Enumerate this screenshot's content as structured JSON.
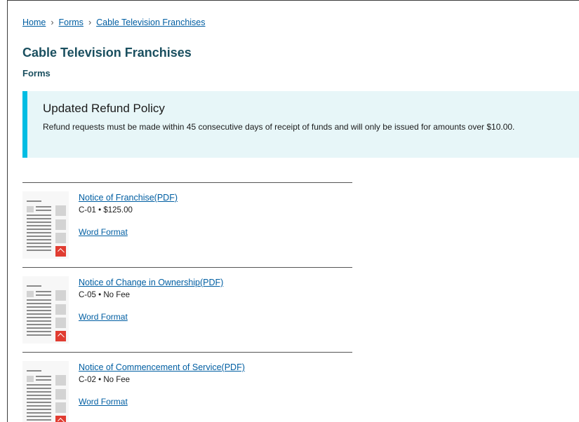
{
  "breadcrumb": {
    "items": [
      "Home",
      "Forms",
      "Cable Television Franchises"
    ],
    "separator": "›"
  },
  "page": {
    "title": "Cable Television Franchises",
    "subtitle": "Forms"
  },
  "alert": {
    "heading": "Updated Refund Policy",
    "body": "Refund requests must be made within 45 consecutive days of receipt of funds and will only be issued for amounts over $10.00."
  },
  "forms": [
    {
      "title": "Notice of Franchise(PDF)",
      "meta": "C-01 • $125.00",
      "word_label": "Word Format"
    },
    {
      "title": "Notice of Change in Ownership(PDF)",
      "meta": "C-05 • No Fee",
      "word_label": "Word Format"
    },
    {
      "title": "Notice of Commencement of Service(PDF)",
      "meta": "C-02 • No Fee",
      "word_label": "Word Format"
    }
  ],
  "colors": {
    "link": "#005ea2",
    "heading": "#1a4f5f",
    "alert_bg": "#e7f6f8",
    "alert_border": "#00bde3",
    "pdf_badge": "#e03c31"
  },
  "icons": {
    "form_thumbnail": "document-thumbnail-icon",
    "pdf_badge": "pdf-icon"
  }
}
